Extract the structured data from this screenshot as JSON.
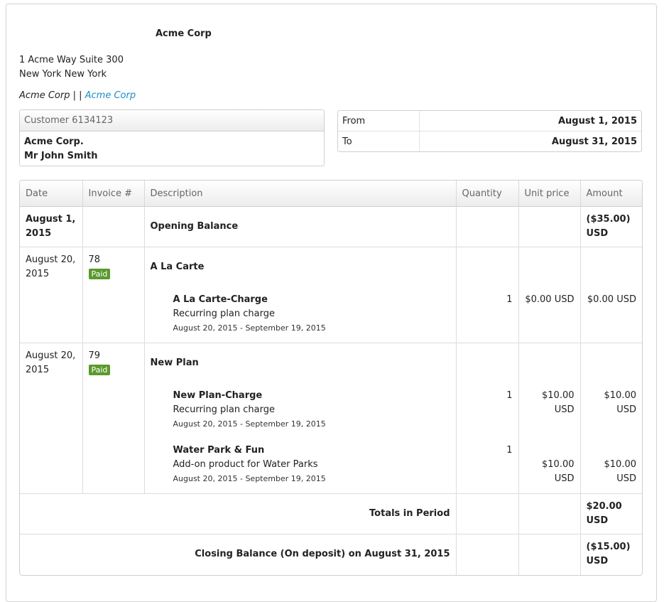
{
  "company": {
    "name": "Acme Corp",
    "address_line1": "1 Acme Way Suite 300",
    "address_line2": "New York New York",
    "link_prefix": "Acme Corp",
    "link_sep": " | | ",
    "link_text": "Acme Corp",
    "link_color": "#1a8fc9"
  },
  "customer": {
    "header": "Customer 6134123",
    "company": "Acme Corp.",
    "contact": "Mr John Smith"
  },
  "period": {
    "from_label": "From",
    "from_value": "August 1, 2015",
    "to_label": "To",
    "to_value": "August 31, 2015"
  },
  "table": {
    "headers": [
      "Date",
      "Invoice #",
      "Description",
      "Quantity",
      "Unit price",
      "Amount"
    ],
    "opening": {
      "date": "August 1, 2015",
      "description": "Opening Balance",
      "amount": "($35.00) USD"
    },
    "invoices": [
      {
        "date": "August 20, 2015",
        "number": "78",
        "status": "Paid",
        "plan": "A La Carte",
        "items": [
          {
            "title": "A La Carte-Charge",
            "desc": "Recurring plan charge",
            "dates": "August 20, 2015 - September 19, 2015",
            "quantity": "1",
            "unit_price": "$0.00 USD",
            "amount": "$0.00 USD"
          }
        ]
      },
      {
        "date": "August 20, 2015",
        "number": "79",
        "status": "Paid",
        "plan": "New Plan",
        "items": [
          {
            "title": "New Plan-Charge",
            "desc": "Recurring plan charge",
            "dates": "August 20, 2015 - September 19, 2015",
            "quantity": "1",
            "unit_price": "$10.00 USD",
            "amount": "$10.00 USD"
          },
          {
            "title": "Water Park & Fun",
            "desc": "Add-on product for Water Parks",
            "dates": "August 20, 2015 - September 19, 2015",
            "quantity": "1",
            "unit_price": "$10.00 USD",
            "amount": "$10.00 USD"
          }
        ]
      }
    ],
    "totals": {
      "label": "Totals in Period",
      "amount": "$20.00 USD"
    },
    "closing": {
      "label": "Closing Balance (On deposit) on August 31, 2015",
      "amount": "($15.00) USD"
    }
  },
  "colors": {
    "paid_badge": "#5a9a2c"
  }
}
